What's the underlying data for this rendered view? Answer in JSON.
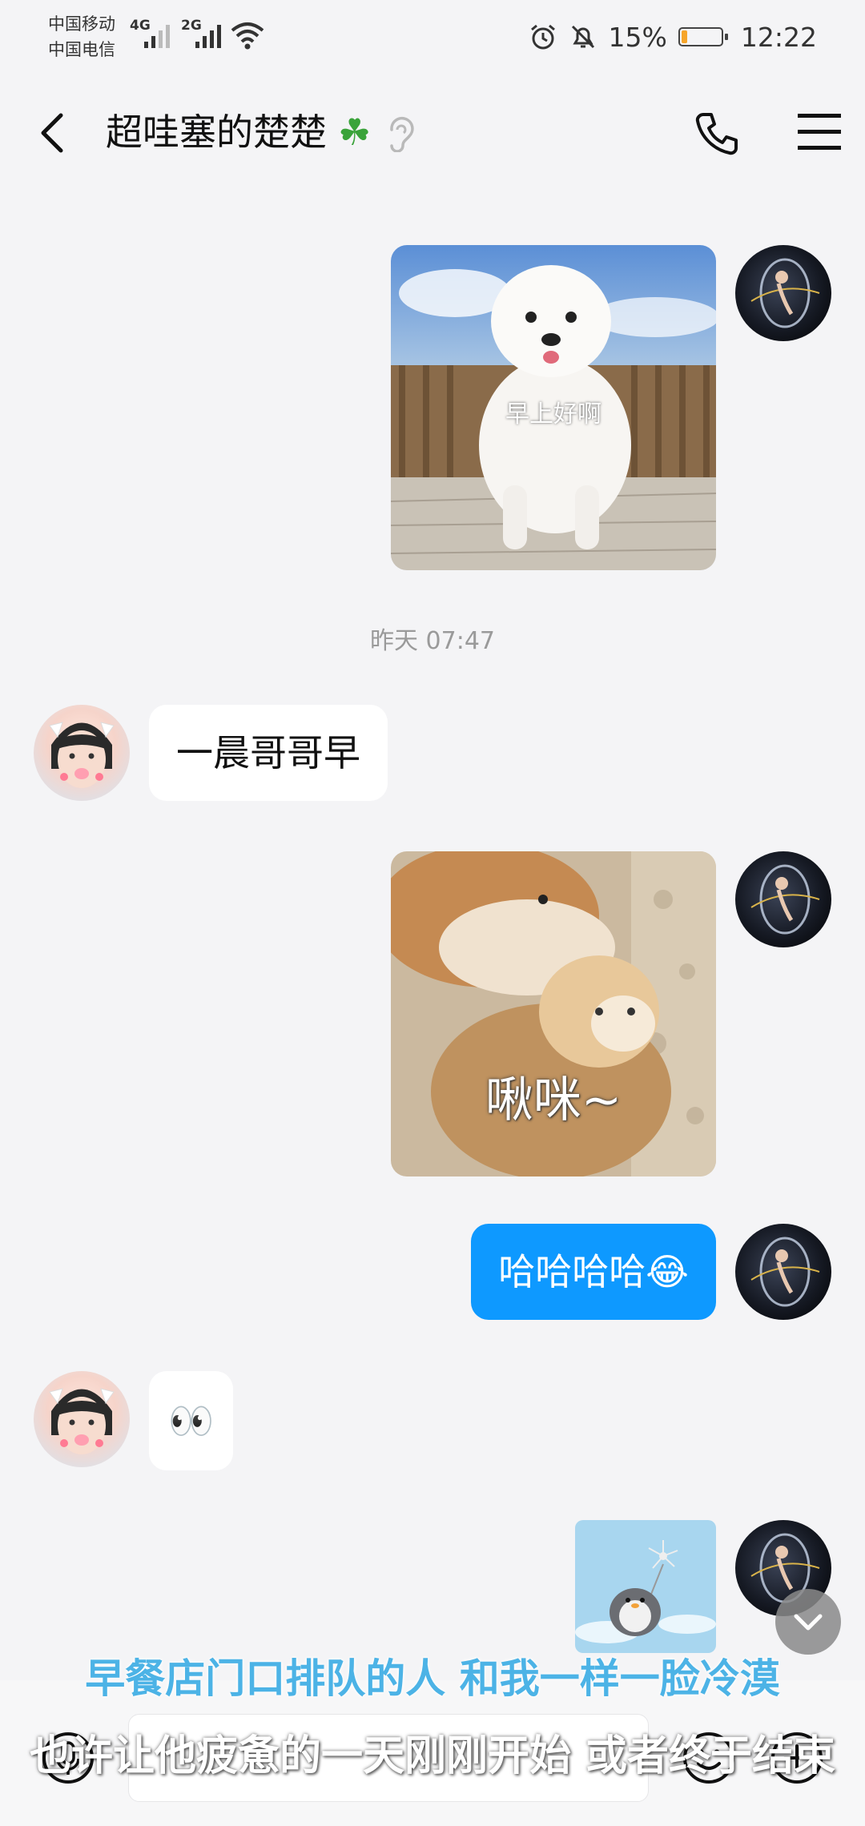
{
  "status_bar": {
    "carrier1": "中国移动",
    "carrier2": "中国电信",
    "net1": "4G",
    "net2": "2G",
    "battery": "15%",
    "battery_level": 0.15,
    "battery_color": "#f6a52a",
    "time": "12:22"
  },
  "header": {
    "title": "超哇塞的楚楚",
    "title_emoji": "☘"
  },
  "messages": {
    "m1_image_caption": "早上好啊",
    "timestamp": "昨天 07:47",
    "m2_text": "一晨哥哥早",
    "m3_image_caption": "啾咪~",
    "m4_text": "哈哈哈哈😂",
    "m5_text": "👀"
  },
  "captions": {
    "line1": "早餐店门口排队的人 和我一样一脸冷漠",
    "line2": "也许让他疲惫的一天刚刚开始 或者终于结束"
  },
  "colors": {
    "accent": "#0e99ff",
    "background": "#f4f4f6",
    "caption_blue": "#4cb3e6"
  }
}
